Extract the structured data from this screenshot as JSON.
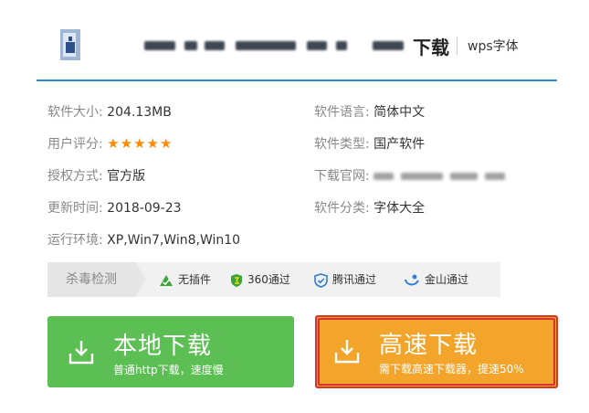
{
  "header": {
    "title_suffix": "下载",
    "tag": "wps字体"
  },
  "info": {
    "size_label": "软件大小:",
    "size_value": "204.13MB",
    "language_label": "软件语言:",
    "language_value": "简体中文",
    "rating_label": "用户评分:",
    "rating_value": 5,
    "type_label": "软件类型:",
    "type_value": "国产软件",
    "license_label": "授权方式:",
    "license_value": "官方版",
    "website_label": "下载官网:",
    "updated_label": "更新时间:",
    "updated_value": "2018-09-23",
    "category_label": "软件分类:",
    "category_value": "字体大全",
    "env_label": "运行环境:",
    "env_value": "XP,Win7,Win8,Win10"
  },
  "scan": {
    "label": "杀毒检测",
    "items": [
      {
        "text": "无插件",
        "icon": "no-plugin-icon",
        "color": "#3aa33a"
      },
      {
        "text": "360通过",
        "icon": "shield-360-icon",
        "color": "#3aa33a"
      },
      {
        "text": "腾讯通过",
        "icon": "tencent-shield-icon",
        "color": "#2f7fd8"
      },
      {
        "text": "金山通过",
        "icon": "kingsoft-icon",
        "color": "#2f7fd8"
      }
    ]
  },
  "buttons": {
    "local_main": "本地下载",
    "local_sub": "普通http下载，速度慢",
    "fast_main": "高速下载",
    "fast_sub": "需下载高速下载器，提速50%"
  },
  "colors": {
    "accent_blue": "#2a8bd8",
    "green": "#5cbf54",
    "orange": "#f2a52a",
    "highlight_red": "#d7342c"
  }
}
